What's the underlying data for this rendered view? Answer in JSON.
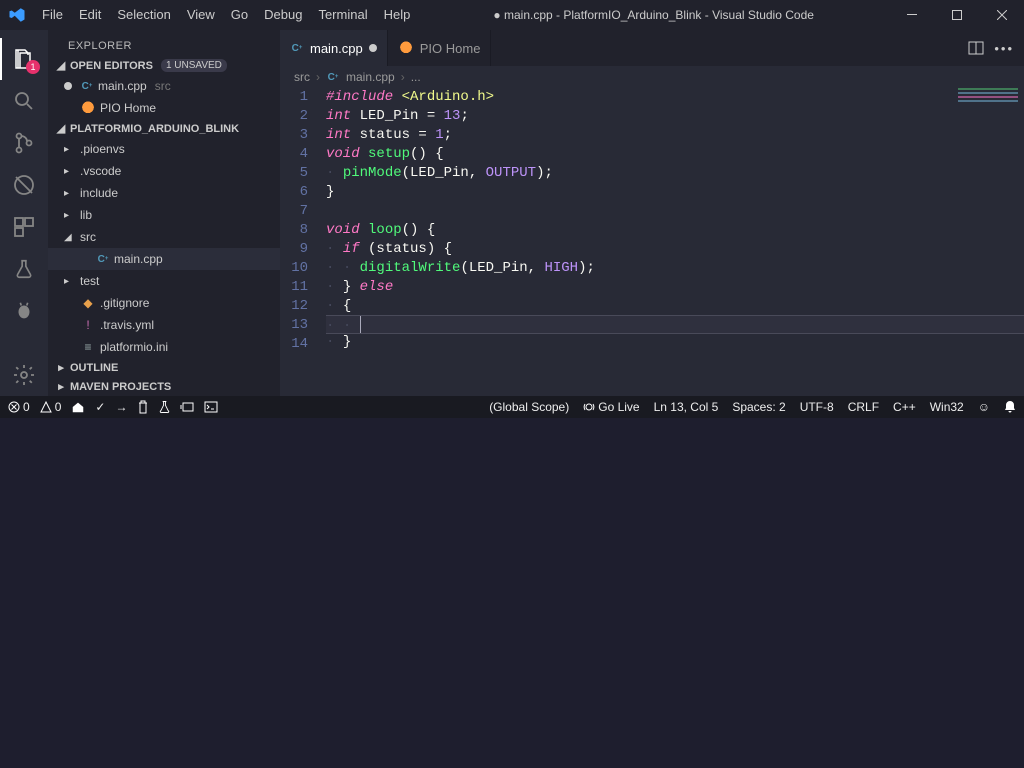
{
  "window_title": "● main.cpp - PlatformIO_Arduino_Blink - Visual Studio Code",
  "menu": [
    "File",
    "Edit",
    "Selection",
    "View",
    "Go",
    "Debug",
    "Terminal",
    "Help"
  ],
  "activity_badge": "1",
  "sidebar": {
    "title": "EXPLORER",
    "open_editors_label": "OPEN EDITORS",
    "unsaved_badge": "1 UNSAVED",
    "open_editors": [
      {
        "label": "main.cpp",
        "dir": "src",
        "icon": "cpp",
        "modified": true
      },
      {
        "label": "PIO Home",
        "icon": "pio"
      }
    ],
    "project_label": "PLATFORMIO_ARDUINO_BLINK",
    "tree": [
      {
        "label": ".pioenvs",
        "kind": "folder"
      },
      {
        "label": ".vscode",
        "kind": "folder"
      },
      {
        "label": "include",
        "kind": "folder"
      },
      {
        "label": "lib",
        "kind": "folder"
      },
      {
        "label": "src",
        "kind": "folder",
        "open": true
      },
      {
        "label": "main.cpp",
        "kind": "file",
        "icon": "cpp",
        "depth": 2,
        "selected": true
      },
      {
        "label": "test",
        "kind": "folder"
      },
      {
        "label": ".gitignore",
        "kind": "file",
        "icon": "git"
      },
      {
        "label": ".travis.yml",
        "kind": "file",
        "icon": "yml"
      },
      {
        "label": "platformio.ini",
        "kind": "file",
        "icon": "ini"
      }
    ],
    "outline_label": "OUTLINE",
    "maven_label": "MAVEN PROJECTS"
  },
  "tabs": [
    {
      "label": "main.cpp",
      "icon": "cpp",
      "modified": true,
      "active": true
    },
    {
      "label": "PIO Home",
      "icon": "pio"
    }
  ],
  "breadcrumbs": [
    "src",
    "main.cpp",
    "..."
  ],
  "code_lines": [
    {
      "n": 1,
      "raw": "#include <Arduino.h>"
    },
    {
      "n": 2,
      "raw": "int LED_Pin = 13;"
    },
    {
      "n": 3,
      "raw": "int status = 1;"
    },
    {
      "n": 4,
      "raw": "void setup() {"
    },
    {
      "n": 5,
      "raw": "  pinMode(LED_Pin, OUTPUT);"
    },
    {
      "n": 6,
      "raw": "}"
    },
    {
      "n": 7,
      "raw": ""
    },
    {
      "n": 8,
      "raw": "void loop() {"
    },
    {
      "n": 9,
      "raw": "  if (status) {"
    },
    {
      "n": 10,
      "raw": "    digitalWrite(LED_Pin, HIGH);"
    },
    {
      "n": 11,
      "raw": "  } else"
    },
    {
      "n": 12,
      "raw": "  {"
    },
    {
      "n": 13,
      "raw": "    ",
      "current": true
    },
    {
      "n": 14,
      "raw": "  }"
    }
  ],
  "status": {
    "errors": "0",
    "warnings": "0",
    "globalscope": "(Global Scope)",
    "golive": "Go Live",
    "pos": "Ln 13, Col 5",
    "spaces": "Spaces: 2",
    "encoding": "UTF-8",
    "eol": "CRLF",
    "lang": "C++",
    "platform": "Win32"
  }
}
